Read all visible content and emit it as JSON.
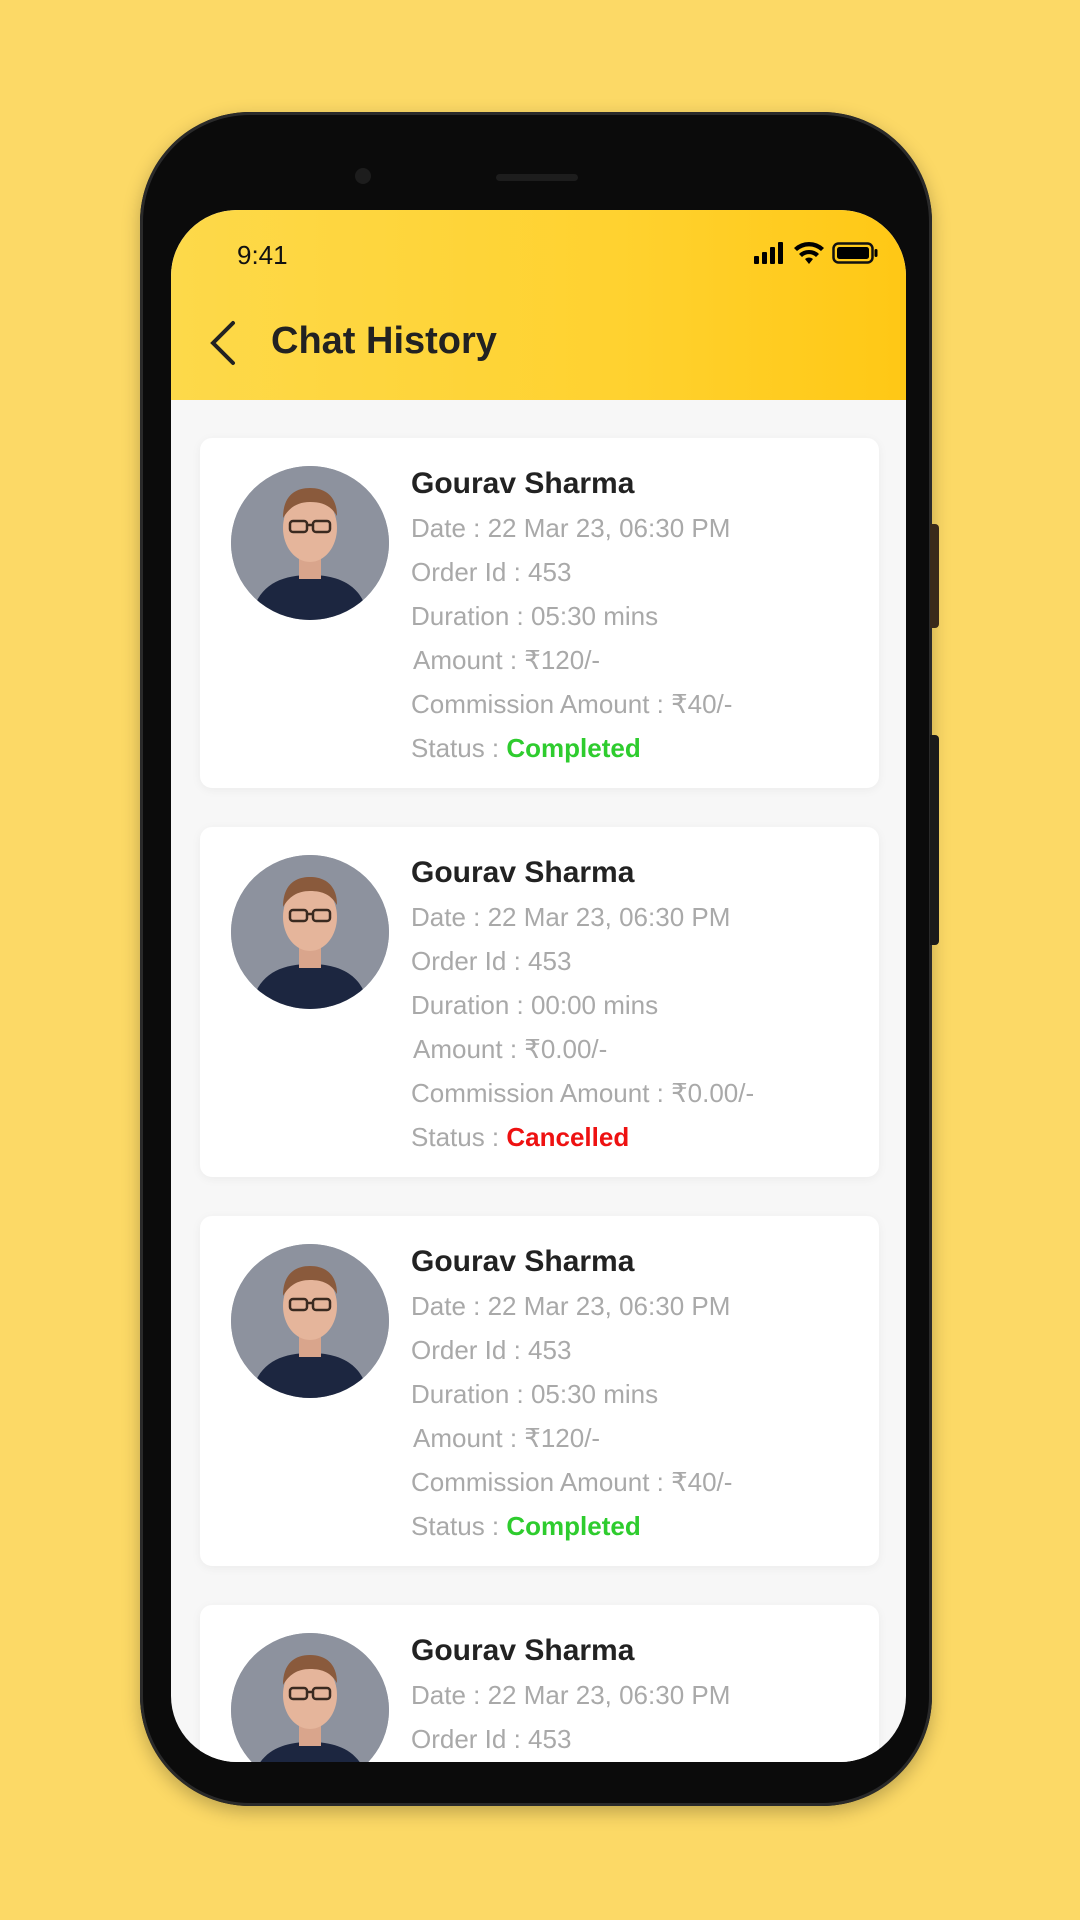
{
  "status_bar": {
    "time": "9:41",
    "icons": [
      "signal-icon",
      "wifi-icon",
      "battery-icon"
    ]
  },
  "header": {
    "title": "Chat History",
    "back_icon": "chevron-left-icon"
  },
  "colors": {
    "background": "#FCD966",
    "header_start": "#FDD94A",
    "header_end": "#FFC815",
    "completed": "#2ECC2E",
    "cancelled": "#EE1111"
  },
  "history": [
    {
      "name": "Gourav Sharma",
      "date": "Date : 22 Mar 23, 06:30 PM",
      "order": "Order Id : 453",
      "duration": "Duration : 05:30 mins",
      "amount": "Amount : ₹120/-",
      "commission": "Commission Amount : ₹40/-",
      "status_label": "Status : ",
      "status": "Completed"
    },
    {
      "name": "Gourav Sharma",
      "date": "Date : 22 Mar 23, 06:30 PM",
      "order": "Order Id : 453",
      "duration": "Duration : 00:00 mins",
      "amount": "Amount : ₹0.00/-",
      "commission": "Commission Amount : ₹0.00/-",
      "status_label": "Status : ",
      "status": "Cancelled"
    },
    {
      "name": "Gourav Sharma",
      "date": "Date : 22 Mar 23, 06:30 PM",
      "order": "Order Id : 453",
      "duration": "Duration : 05:30 mins",
      "amount": "Amount : ₹120/-",
      "commission": "Commission Amount : ₹40/-",
      "status_label": "Status : ",
      "status": "Completed"
    },
    {
      "name": "Gourav Sharma",
      "date": "Date : 22 Mar 23, 06:30 PM",
      "order": "Order Id : 453"
    }
  ]
}
